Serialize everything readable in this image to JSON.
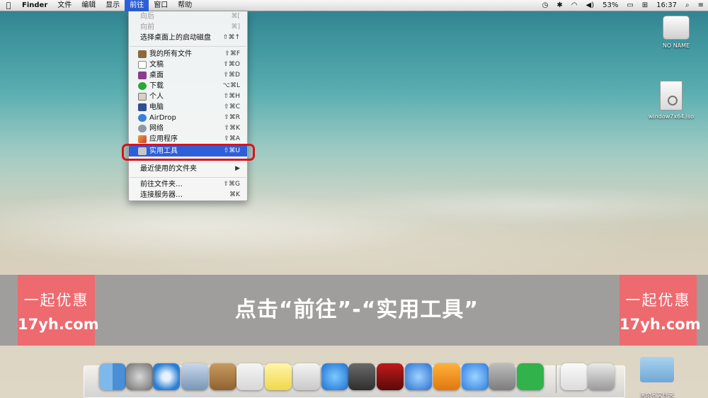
{
  "menubar": {
    "app_name": "Finder",
    "items": [
      "文件",
      "编辑",
      "显示",
      "前往",
      "窗口",
      "帮助"
    ],
    "active_item": "前往",
    "status": {
      "battery": "53%",
      "time": "16:37"
    }
  },
  "go_menu": {
    "items": [
      {
        "label": "向后",
        "shortcut": "⌘[",
        "disabled": true
      },
      {
        "label": "向前",
        "shortcut": "⌘]",
        "disabled": true
      },
      {
        "label": "选择桌面上的启动磁盘",
        "shortcut": "⇧⌘↑",
        "disabled": false
      },
      {
        "label": "我的所有文件",
        "shortcut": "⇧⌘F",
        "icon": "all-files-icon"
      },
      {
        "label": "文稿",
        "shortcut": "⇧⌘O",
        "icon": "documents-icon"
      },
      {
        "label": "桌面",
        "shortcut": "⇧⌘D",
        "icon": "desktop-icon"
      },
      {
        "label": "下载",
        "shortcut": "⌥⌘L",
        "icon": "downloads-icon"
      },
      {
        "label": "个人",
        "shortcut": "⇧⌘H",
        "icon": "home-icon"
      },
      {
        "label": "电脑",
        "shortcut": "⇧⌘C",
        "icon": "computer-icon"
      },
      {
        "label": "AirDrop",
        "shortcut": "⇧⌘R",
        "icon": "airdrop-icon"
      },
      {
        "label": "网络",
        "shortcut": "⇧⌘K",
        "icon": "network-icon"
      },
      {
        "label": "应用程序",
        "shortcut": "⇧⌘A",
        "icon": "applications-icon"
      },
      {
        "label": "实用工具",
        "shortcut": "⇧⌘U",
        "icon": "utilities-icon",
        "highlighted": true
      },
      {
        "label": "最近使用的文件夹",
        "shortcut": "▶"
      },
      {
        "label": "前往文件夹…",
        "shortcut": "⇧⌘G"
      },
      {
        "label": "连接服务器…",
        "shortcut": "⌘K"
      }
    ]
  },
  "desktop_icons": [
    {
      "label": "NO NAME"
    },
    {
      "label": "window7x64.iso"
    }
  ],
  "caption": "点击“前往”-“实用工具”",
  "watermark": {
    "line1": "一起优惠",
    "line2": "17yh.com"
  },
  "dock_folder_label": "未命名文件夹",
  "colors": {
    "highlight": "#2f5fd8",
    "ring": "#e0101a",
    "watermark_bg": "#ed6a6f"
  }
}
